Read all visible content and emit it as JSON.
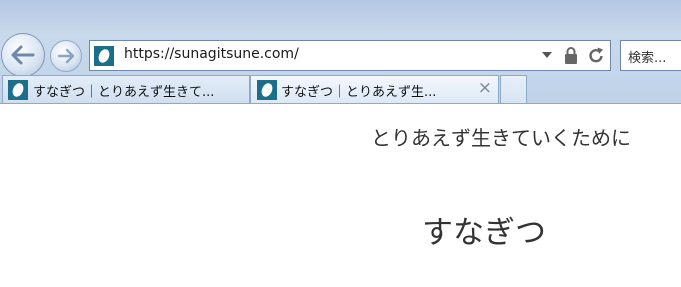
{
  "browser": {
    "address_bar": {
      "url": "https://sunagitsune.com/"
    },
    "search_box": {
      "placeholder": "検索..."
    },
    "tabs": [
      {
        "label": "すなぎつ｜とりあえず生きて...",
        "active": false
      },
      {
        "label": "すなぎつ｜とりあえず生...",
        "active": true,
        "close": "×"
      }
    ],
    "icons": {
      "back": "back-arrow-icon",
      "forward": "forward-arrow-icon",
      "dropdown": "dropdown-arrow-icon",
      "lock": "lock-icon",
      "refresh": "refresh-icon",
      "close": "close-icon",
      "favicon": "site-favicon-icon"
    },
    "colors": {
      "chrome": "#c4d6ea",
      "favicon": "#1c6f8a"
    }
  },
  "page": {
    "tagline": "とりあえず生きていくために",
    "title": "すなぎつ"
  }
}
